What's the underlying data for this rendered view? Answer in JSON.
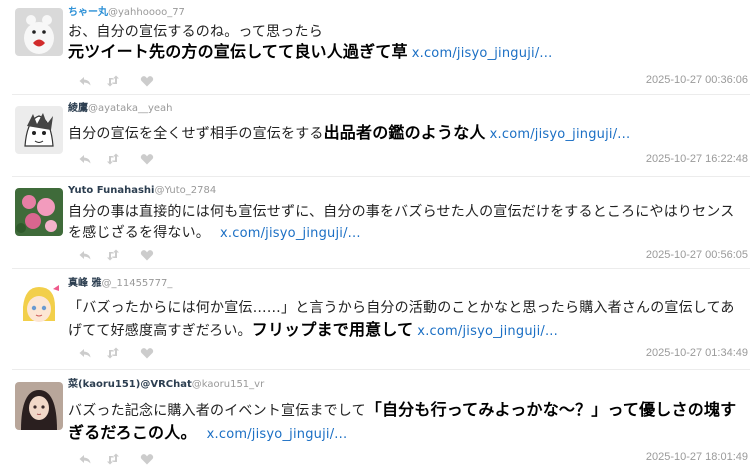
{
  "tweets": [
    {
      "name": "ちゃー丸",
      "handle": "@yahhoooo_77",
      "text_plain": "お、自分の宣伝するのね。って思ったら",
      "text_bold": "元ツイート先の方の宣伝してて良い人過ぎて草",
      "link": "x.com/jisyo_jinguji/...",
      "timestamp": "2025-10-27 00:36:06"
    },
    {
      "name": "綾鷹",
      "handle": "@ayataka__yeah",
      "text_plain": "自分の宣伝を全くせず相手の宣伝をする",
      "text_bold": "出品者の鑑のような人",
      "link": "x.com/jisyo_jinguji/...",
      "timestamp": "2025-10-27 16:22:48"
    },
    {
      "name": "Yuto Funahashi",
      "handle": "@Yuto_2784",
      "text_plain": "自分の事は直接的には何も宣伝せずに、自分の事をバズらせた人の宣伝だけをするところにやはりセンスを感じざるを得ない。",
      "link": "x.com/jisyo_jinguji/...",
      "timestamp": "2025-10-27 00:56:05"
    },
    {
      "name": "真峰 雅",
      "handle": "@_11455777_",
      "text_plain": "「バズったからには何か宣伝……」と言うから自分の活動のことかなと思ったら購入者さんの宣伝してあげてて好感度高すぎだろい。",
      "text_bold": "フリップまで用意して",
      "link": "x.com/jisyo_jinguji/...",
      "timestamp": "2025-10-27 01:34:49"
    },
    {
      "name": "菜(kaoru151)@VRChat",
      "handle": "@kaoru151_vr",
      "text_plain": "バズった記念に購入者のイベント宣伝までして",
      "text_bold": "「自分も行ってみよっかな～？」って優しさの塊すぎるだろこの人。",
      "link": "x.com/jisyo_jinguji/...",
      "timestamp": "2025-10-27 18:01:49"
    }
  ],
  "icons": {
    "reply": "reply-icon",
    "retweet": "retweet-icon",
    "like": "heart-icon"
  },
  "colors": {
    "name_blue": "#2a8fd6",
    "link": "#1b6fc4",
    "timestamp": "#9a9a9a",
    "action_icons": "#cccccc"
  }
}
